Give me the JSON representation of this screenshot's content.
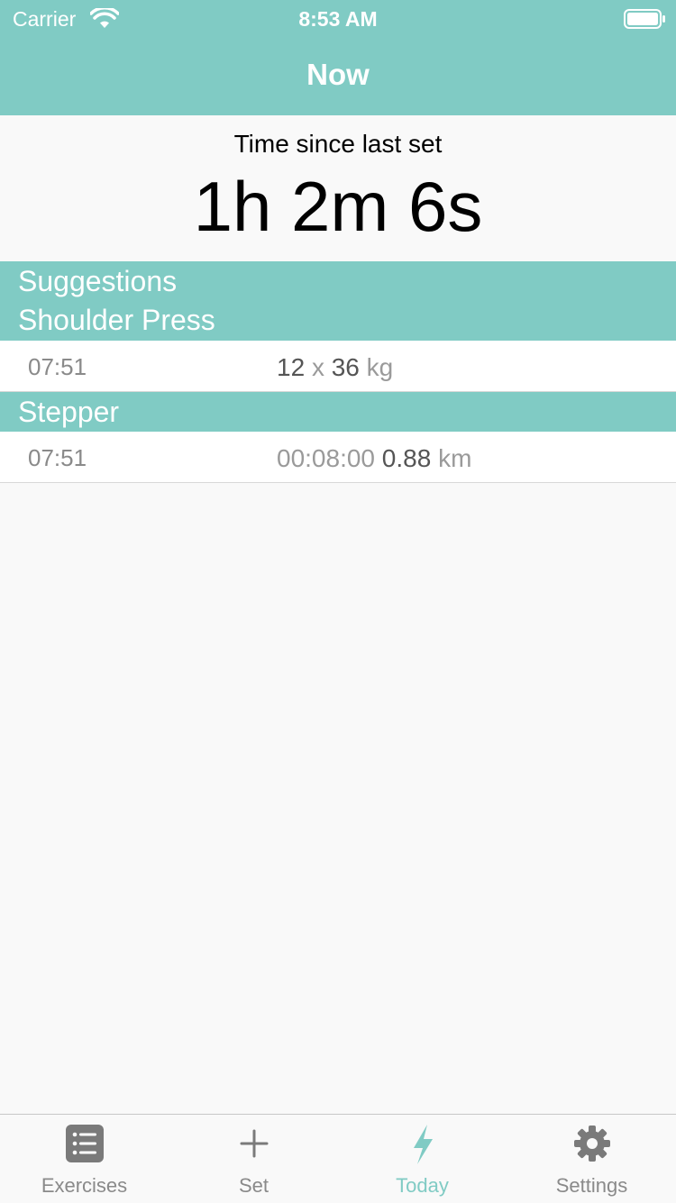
{
  "status_bar": {
    "carrier": "Carrier",
    "time": "8:53 AM"
  },
  "nav": {
    "title": "Now"
  },
  "timer": {
    "label": "Time since last set",
    "value": "1h 2m 6s"
  },
  "suggestions": {
    "title": "Suggestions",
    "groups": [
      {
        "name": "Shoulder Press",
        "rows": [
          {
            "time": "07:51",
            "reps": "12",
            "x": "x",
            "weight": "36",
            "unit": "kg"
          }
        ]
      },
      {
        "name": "Stepper",
        "rows": [
          {
            "time": "07:51",
            "duration": "00:08:00",
            "distance": "0.88",
            "unit": "km"
          }
        ]
      }
    ]
  },
  "tabs": [
    {
      "label": "Exercises",
      "icon": "list-icon"
    },
    {
      "label": "Set",
      "icon": "plus-icon"
    },
    {
      "label": "Today",
      "icon": "bolt-icon",
      "active": true
    },
    {
      "label": "Settings",
      "icon": "gear-icon"
    }
  ],
  "colors": {
    "accent": "#80cbc4",
    "background": "#f9f9f9",
    "inactive": "#8a8a8a"
  }
}
